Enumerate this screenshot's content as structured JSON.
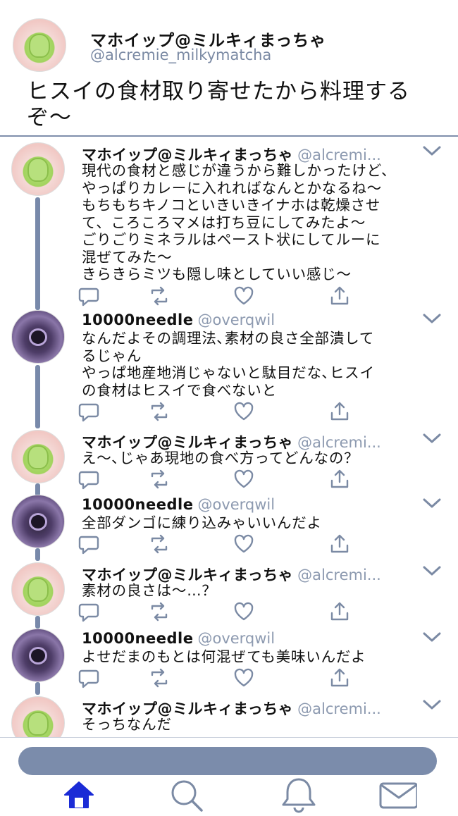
{
  "header": {
    "name": "マホイップ@ミルキィまっちゃ",
    "handle": "@alcremie_milkymatcha",
    "text": "ヒスイの食材取り寄せたから料理するぞ〜"
  },
  "tweets": [
    {
      "name": "マホイップ@ミルキィまっちゃ",
      "handle": "@alcremi...",
      "avatar": "alcremie-avatar",
      "lines": [
        "現代の食材と感じが違うから難しかったけど、",
        "やっぱりカレーに入れればなんとかなるね〜",
        "もちもちキノコといきいきイナホは乾燥させ",
        "て、ころころマメは打ち豆にしてみたよ〜",
        "ごりごりミネラルはペースト状にしてルーに",
        "混ぜてみた〜",
        "きらきらミツも隠し味としていい感じ〜"
      ]
    },
    {
      "name": "10000needle",
      "handle": "@overqwil",
      "avatar": "overqwil-avatar",
      "lines": [
        "なんだよその調理法､素材の良さ全部潰して",
        "るじゃん",
        "やっぱ地産地消じゃないと駄目だな､ヒスイ",
        "の食材はヒスイで食べないと"
      ]
    },
    {
      "name": "マホイップ@ミルキィまっちゃ",
      "handle": "@alcremi...",
      "avatar": "alcremie-avatar",
      "lines": [
        "え〜､じゃあ現地の食べ方ってどんなの？"
      ]
    },
    {
      "name": "10000needle",
      "handle": "@overqwil",
      "avatar": "overqwil-avatar",
      "lines": [
        "全部ダンゴに練り込みゃいいんだよ"
      ]
    },
    {
      "name": "マホイップ@ミルキィまっちゃ",
      "handle": "@alcremi...",
      "avatar": "alcremie-avatar",
      "lines": [
        "素材の良さは〜…？"
      ]
    },
    {
      "name": "10000needle",
      "handle": "@overqwil",
      "avatar": "overqwil-avatar",
      "lines": [
        "よせだまのもとは何混ぜても美味いんだよ"
      ]
    },
    {
      "name": "マホイップ@ミルキィまっちゃ",
      "handle": "@alcremi...",
      "avatar": "alcremie-avatar",
      "lines": [
        "そっちなんだ"
      ]
    }
  ],
  "action_icons": [
    "reply-icon",
    "retweet-icon",
    "like-icon",
    "share-icon"
  ],
  "nav": [
    "home-icon",
    "search-icon",
    "notifications-icon",
    "messages-icon"
  ],
  "colors": {
    "accent": "#7889aa",
    "handle": "#8d9ab0",
    "home_active": "#1a2bd6",
    "icon": "#7b8aa4"
  }
}
